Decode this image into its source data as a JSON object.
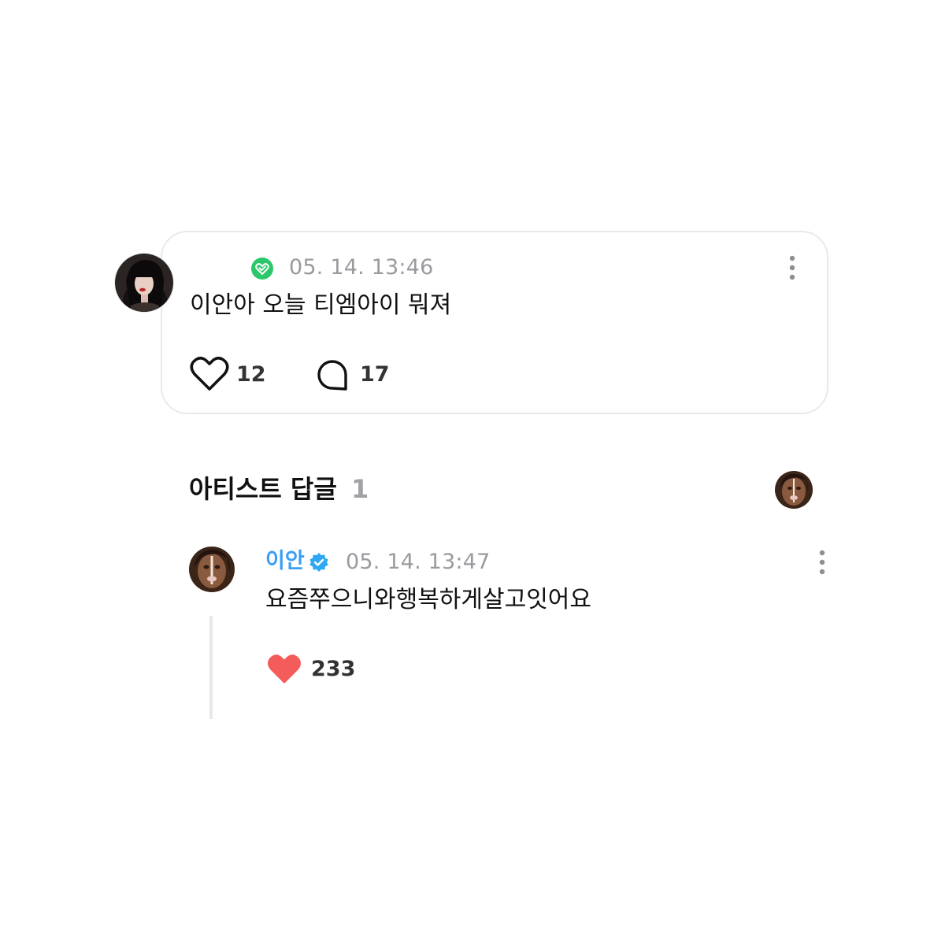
{
  "post": {
    "author_badge_icon": "membership-heart-icon",
    "badge_color": "#2bc76a",
    "timestamp": "05. 14. 13:46",
    "body": "이안아 오늘 티엠아이 뭐져",
    "like_count": "12",
    "comment_count": "17",
    "like_icon": "heart-outline-icon",
    "comment_icon": "speech-bubble-icon",
    "more_icon": "more-vertical-icon"
  },
  "artist_replies": {
    "title": "아티스트 답글",
    "count": "1"
  },
  "reply": {
    "author": "이안",
    "author_color": "#3a9ef5",
    "verified_icon": "verified-badge-icon",
    "verified_color": "#2ea8f2",
    "timestamp": "05. 14. 13:47",
    "body": "요즘쭈으니와행복하게살고잇어요",
    "like_count": "233",
    "like_icon": "heart-filled-icon",
    "like_color": "#f45b5b",
    "more_icon": "more-vertical-icon"
  }
}
